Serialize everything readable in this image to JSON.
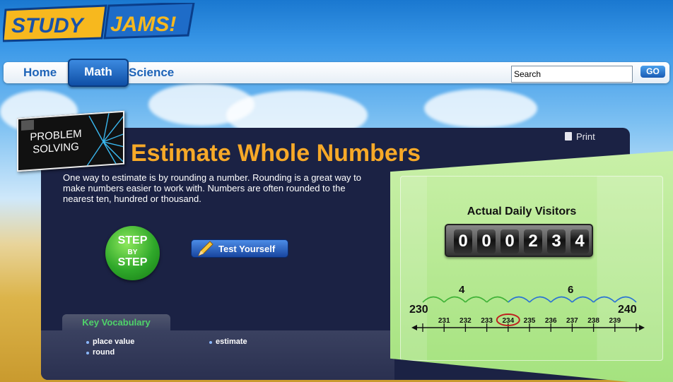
{
  "logo": {
    "word1": "STUDY",
    "word2": "JAMS!"
  },
  "nav": {
    "home": "Home",
    "math": "Math",
    "science": "Science"
  },
  "search": {
    "value": "Search",
    "go": "GO"
  },
  "panel": {
    "badge": "PROBLEM SOLVING",
    "title": "Estimate Whole Numbers",
    "print": "Print",
    "intro": "One way to estimate is by rounding a number. Rounding is a great way to make numbers easier to work with. Numbers are often rounded to the nearest ten, hundred or thousand.",
    "step_button": {
      "line1": "STEP",
      "line2": "BY",
      "line3": "STEP"
    },
    "test_yourself": "Test Yourself"
  },
  "vocab": {
    "tab": "Key Vocabulary",
    "items": [
      "place value",
      "round",
      "estimate"
    ]
  },
  "illustration": {
    "counter_title": "Actual Daily Visitors",
    "digits": [
      "0",
      "0",
      "0",
      "2",
      "3",
      "4"
    ],
    "number_line": {
      "start": "230",
      "end": "240",
      "ticks": [
        "231",
        "232",
        "233",
        "234",
        "235",
        "236",
        "237",
        "238",
        "239"
      ],
      "highlight": "234",
      "left_count": "4",
      "right_count": "6"
    }
  },
  "colors": {
    "title": "#f7a928",
    "panel": "#1b2244",
    "vocab_title": "#4fd36a",
    "green_arc": "#3fb236",
    "blue_arc": "#2a72d4",
    "highlight_ring": "#c02020"
  }
}
